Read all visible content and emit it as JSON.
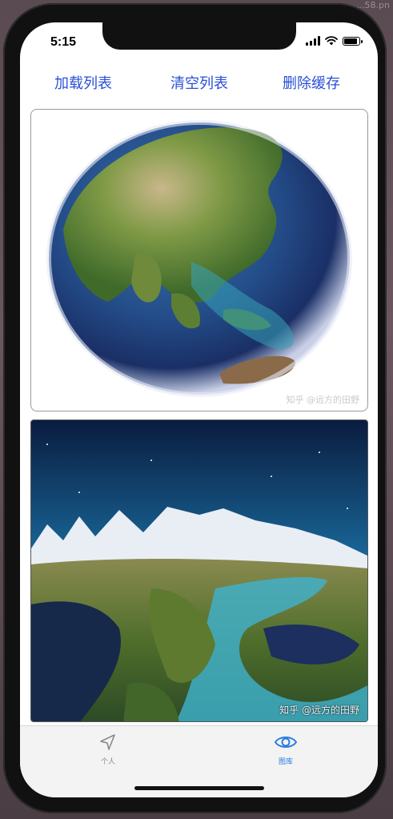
{
  "window": {
    "title_fragment": "...58.pn"
  },
  "status_bar": {
    "time": "5:15"
  },
  "toolbar": {
    "load_label": "加载列表",
    "clear_label": "清空列表",
    "delete_cache_label": "删除缓存"
  },
  "cards": [
    {
      "watermark": "知乎 @远方的田野"
    },
    {
      "watermark": "知乎 @远方的田野"
    }
  ],
  "tabbar": {
    "items": [
      {
        "label": "个人",
        "icon": "location-arrow-icon",
        "active": false
      },
      {
        "label": "图库",
        "icon": "eye-icon",
        "active": true
      }
    ]
  },
  "colors": {
    "accent_blue": "#2a4fd8",
    "tab_active": "#2a7de1",
    "tab_inactive": "#8a8a8a"
  }
}
